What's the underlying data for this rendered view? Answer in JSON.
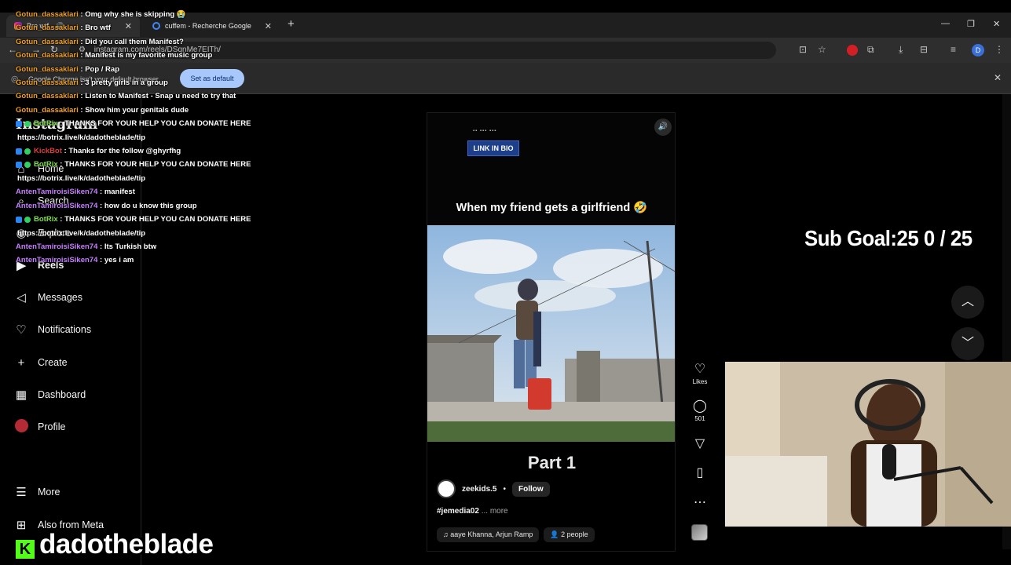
{
  "browser": {
    "tabs": [
      {
        "label": "Bro wtf",
        "active": true
      },
      {
        "label": "cuffem - Recherche Google",
        "active": false
      }
    ],
    "new_tab": "+",
    "url": "instagram.com/reels/DSqnMe7EITh/",
    "infobar": {
      "message": "Google Chrome isn't your default browser",
      "button": "Set as default"
    },
    "profile_initial": "D"
  },
  "sidebar": {
    "items": [
      {
        "label": "Home",
        "icon": "home-icon"
      },
      {
        "label": "Search",
        "icon": "search-icon"
      },
      {
        "label": "Explore",
        "icon": "explore-icon"
      },
      {
        "label": "Reels",
        "icon": "reels-icon"
      },
      {
        "label": "Messages",
        "icon": "messages-icon"
      },
      {
        "label": "Notifications",
        "icon": "heart-icon"
      },
      {
        "label": "Create",
        "icon": "plus-icon"
      },
      {
        "label": "Dashboard",
        "icon": "dashboard-icon"
      },
      {
        "label": "Profile",
        "icon": "avatar"
      },
      {
        "label": "More",
        "icon": "menu-icon"
      },
      {
        "label": "Also from Meta",
        "icon": "meta-icon"
      }
    ]
  },
  "reel": {
    "link_in_bio": "LINK IN BIO",
    "caption_top": "When my friend gets a girlfriend 🤣",
    "part_title": "Part 1",
    "author": "zeekids.5",
    "dot": "•",
    "follow": "Follow",
    "hashtag": "#jemedia02",
    "more": "... more",
    "audio": "aaye Khanna, Arjun Ramp",
    "people": "2 people",
    "actions": {
      "likes_label": "Likes",
      "comments_count": "501"
    }
  },
  "stream": {
    "sub_goal": "Sub Goal:25  0 / 25",
    "channel": "dadotheblade",
    "chat": [
      {
        "user": "Gotun_dassaklari",
        "color": "#f0a020",
        "text": "Omg why she is skipping 😭"
      },
      {
        "user": "Gotun_dassaklari",
        "color": "#f0a020",
        "text": "Bro wtf"
      },
      {
        "user": "Gotun_dassaklari",
        "color": "#f0a020",
        "text": "Did you call them Manifest?"
      },
      {
        "user": "Gotun_dassaklari",
        "color": "#f0a020",
        "text": "Manifest is my favorite music group"
      },
      {
        "user": "Gotun_dassaklari",
        "color": "#f0a020",
        "text": "Pop / Rap"
      },
      {
        "user": "Gotun_dassaklari",
        "color": "#f0a020",
        "text": "3 pretty girls in a group"
      },
      {
        "user": "Gotun_dassaklari",
        "color": "#f0a020",
        "text": "Listen to Manifest - Snap u need to try that"
      },
      {
        "user": "Gotun_dassaklari",
        "color": "#f0a020",
        "text": "Show him your genitals dude"
      },
      {
        "user": "BotRix",
        "color": "#7fe04a",
        "text": "THANKS FOR YOUR HELP YOU CAN DONATE HERE",
        "bot": true,
        "url": "https://botrix.live/k/dadotheblade/tip"
      },
      {
        "user": "KickBot",
        "color": "#e03c3c",
        "text": "Thanks for the follow @ghyrfhg",
        "bot": true
      },
      {
        "user": "BotRix",
        "color": "#7fe04a",
        "text": "THANKS FOR YOUR HELP YOU CAN DONATE HERE",
        "bot": true,
        "url": "https://botrix.live/k/dadotheblade/tip"
      },
      {
        "user": "AntenTamiroisiSiken74",
        "color": "#c77dff",
        "text": "manifest"
      },
      {
        "user": "AntenTamiroisiSiken74",
        "color": "#c77dff",
        "text": "how do u know this group"
      },
      {
        "user": "BotRix",
        "color": "#7fe04a",
        "text": "THANKS FOR YOUR HELP YOU CAN DONATE HERE",
        "bot": true,
        "url": "https://botrix.live/k/dadotheblade/tip"
      },
      {
        "user": "AntenTamiroisiSiken74",
        "color": "#c77dff",
        "text": "Its Turkish btw"
      },
      {
        "user": "AntenTamiroisiSiken74",
        "color": "#c77dff",
        "text": "yes i am"
      }
    ]
  }
}
